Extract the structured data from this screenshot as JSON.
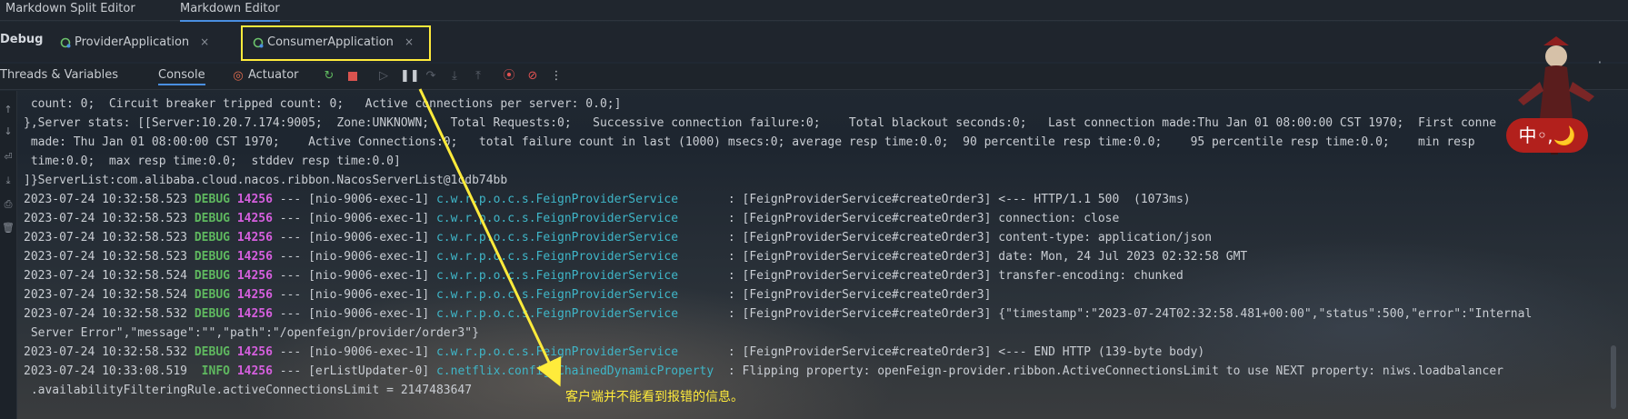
{
  "top_tabs": [
    {
      "label": "Markdown Split Editor",
      "active": false
    },
    {
      "label": "Markdown Editor",
      "active": true
    }
  ],
  "debug_bar": {
    "label": "Debug",
    "tabs": [
      {
        "label": "ProviderApplication",
        "close": "×"
      },
      {
        "label": "ConsumerApplication",
        "close": "×"
      }
    ],
    "kebab": "⋮"
  },
  "toolbar": {
    "threads_variables": "Threads & Variables",
    "console": "Console",
    "actuator": "Actuator"
  },
  "console_lines": [
    [
      {
        "t": " count: 0;  Circuit breaker tripped count: 0;   Active connections per server: 0.0;]",
        "c": "c-plain"
      }
    ],
    [
      {
        "t": "},Server stats: [[Server:10.20.7.174:9005;  Zone:UNKNOWN;   Total Requests:0;   Successive connection failure:0;    Total blackout seconds:0;   Last connection made:Thu Jan 01 08:00:00 CST 1970;  First conne",
        "c": "c-plain"
      }
    ],
    [
      {
        "t": " made: Thu Jan 01 08:00:00 CST 1970;    Active Connections:0;   total failure count in last (1000) msecs:0; average resp time:0.0;  90 percentile resp time:0.0;    95 percentile resp time:0.0;    min resp",
        "c": "c-plain"
      }
    ],
    [
      {
        "t": " time:0.0;  max resp time:0.0;  stddev resp time:0.0]",
        "c": "c-plain"
      }
    ],
    [
      {
        "t": "]}ServerList:com.alibaba.cloud.nacos.ribbon.NacosServerList@1cdb74bb",
        "c": "c-plain"
      }
    ],
    [
      {
        "t": "2023-07-24 10:32:58.523 ",
        "c": "c-plain"
      },
      {
        "t": "DEBUG",
        "c": "c-debug"
      },
      {
        "t": " ",
        "c": "c-plain"
      },
      {
        "t": "14256",
        "c": "c-pid"
      },
      {
        "t": " --- [nio-9006-exec-1] ",
        "c": "c-plain"
      },
      {
        "t": "c.w.r.p.o.c.s.FeignProviderService      ",
        "c": "c-logger"
      },
      {
        "t": " : [FeignProviderService#createOrder3] <--- HTTP/1.1 500  (1073ms)",
        "c": "c-plain"
      }
    ],
    [
      {
        "t": "2023-07-24 10:32:58.523 ",
        "c": "c-plain"
      },
      {
        "t": "DEBUG",
        "c": "c-debug"
      },
      {
        "t": " ",
        "c": "c-plain"
      },
      {
        "t": "14256",
        "c": "c-pid"
      },
      {
        "t": " --- [nio-9006-exec-1] ",
        "c": "c-plain"
      },
      {
        "t": "c.w.r.p.o.c.s.FeignProviderService      ",
        "c": "c-logger"
      },
      {
        "t": " : [FeignProviderService#createOrder3] connection: close",
        "c": "c-plain"
      }
    ],
    [
      {
        "t": "2023-07-24 10:32:58.523 ",
        "c": "c-plain"
      },
      {
        "t": "DEBUG",
        "c": "c-debug"
      },
      {
        "t": " ",
        "c": "c-plain"
      },
      {
        "t": "14256",
        "c": "c-pid"
      },
      {
        "t": " --- [nio-9006-exec-1] ",
        "c": "c-plain"
      },
      {
        "t": "c.w.r.p.o.c.s.FeignProviderService      ",
        "c": "c-logger"
      },
      {
        "t": " : [FeignProviderService#createOrder3] content-type: application/json",
        "c": "c-plain"
      }
    ],
    [
      {
        "t": "2023-07-24 10:32:58.523 ",
        "c": "c-plain"
      },
      {
        "t": "DEBUG",
        "c": "c-debug"
      },
      {
        "t": " ",
        "c": "c-plain"
      },
      {
        "t": "14256",
        "c": "c-pid"
      },
      {
        "t": " --- [nio-9006-exec-1] ",
        "c": "c-plain"
      },
      {
        "t": "c.w.r.p.o.c.s.FeignProviderService      ",
        "c": "c-logger"
      },
      {
        "t": " : [FeignProviderService#createOrder3] date: Mon, 24 Jul 2023 02:32:58 GMT",
        "c": "c-plain"
      }
    ],
    [
      {
        "t": "2023-07-24 10:32:58.524 ",
        "c": "c-plain"
      },
      {
        "t": "DEBUG",
        "c": "c-debug"
      },
      {
        "t": " ",
        "c": "c-plain"
      },
      {
        "t": "14256",
        "c": "c-pid"
      },
      {
        "t": " --- [nio-9006-exec-1] ",
        "c": "c-plain"
      },
      {
        "t": "c.w.r.p.o.c.s.FeignProviderService      ",
        "c": "c-logger"
      },
      {
        "t": " : [FeignProviderService#createOrder3] transfer-encoding: chunked",
        "c": "c-plain"
      }
    ],
    [
      {
        "t": "2023-07-24 10:32:58.524 ",
        "c": "c-plain"
      },
      {
        "t": "DEBUG",
        "c": "c-debug"
      },
      {
        "t": " ",
        "c": "c-plain"
      },
      {
        "t": "14256",
        "c": "c-pid"
      },
      {
        "t": " --- [nio-9006-exec-1] ",
        "c": "c-plain"
      },
      {
        "t": "c.w.r.p.o.c.s.FeignProviderService      ",
        "c": "c-logger"
      },
      {
        "t": " : [FeignProviderService#createOrder3]",
        "c": "c-plain"
      }
    ],
    [
      {
        "t": "2023-07-24 10:32:58.532 ",
        "c": "c-plain"
      },
      {
        "t": "DEBUG",
        "c": "c-debug"
      },
      {
        "t": " ",
        "c": "c-plain"
      },
      {
        "t": "14256",
        "c": "c-pid"
      },
      {
        "t": " --- [nio-9006-exec-1] ",
        "c": "c-plain"
      },
      {
        "t": "c.w.r.p.o.c.s.FeignProviderService      ",
        "c": "c-logger"
      },
      {
        "t": " : [FeignProviderService#createOrder3] {\"timestamp\":\"2023-07-24T02:32:58.481+00:00\",\"status\":500,\"error\":\"Internal",
        "c": "c-plain"
      }
    ],
    [
      {
        "t": " Server Error\",\"message\":\"\",\"path\":\"/openfeign/provider/order3\"}",
        "c": "c-plain"
      }
    ],
    [
      {
        "t": "2023-07-24 10:32:58.532 ",
        "c": "c-plain"
      },
      {
        "t": "DEBUG",
        "c": "c-debug"
      },
      {
        "t": " ",
        "c": "c-plain"
      },
      {
        "t": "14256",
        "c": "c-pid"
      },
      {
        "t": " --- [nio-9006-exec-1] ",
        "c": "c-plain"
      },
      {
        "t": "c.w.r.p.o.c.s.FeignProviderService      ",
        "c": "c-logger"
      },
      {
        "t": " : [FeignProviderService#createOrder3] <--- END HTTP (139-byte body)",
        "c": "c-plain"
      }
    ],
    [
      {
        "t": "2023-07-24 10:33:08.519 ",
        "c": "c-plain"
      },
      {
        "t": " INFO",
        "c": "c-info"
      },
      {
        "t": " ",
        "c": "c-plain"
      },
      {
        "t": "14256",
        "c": "c-pid"
      },
      {
        "t": " --- [erListUpdater-0] ",
        "c": "c-plain"
      },
      {
        "t": "c.netflix.config.ChainedDynamicProperty ",
        "c": "c-logger"
      },
      {
        "t": " : Flipping property: openFeign-provider.ribbon.ActiveConnectionsLimit to use NEXT property: niws.loadbalancer",
        "c": "c-plain"
      }
    ],
    [
      {
        "t": " .availabilityFilteringRule.activeConnectionsLimit = 2147483647",
        "c": "c-plain"
      }
    ]
  ],
  "annotation": "客户端并不能看到报错的信息。",
  "mascot_chip": "中◦,🌙",
  "colors": {
    "highlight": "#ffeb3b",
    "debug": "#5fb85f",
    "pid": "#d55fde",
    "logger": "#3fb6c8"
  }
}
